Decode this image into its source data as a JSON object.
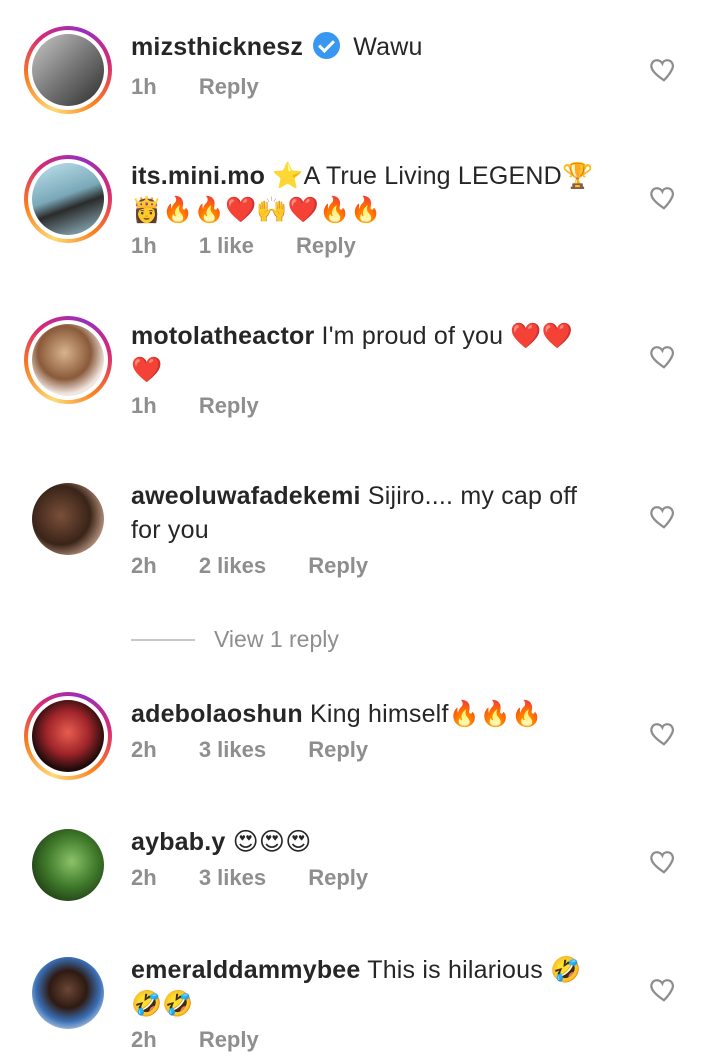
{
  "comments": [
    {
      "username": "mizsthicknesz",
      "verified": true,
      "text": "Wawu",
      "time": "1h",
      "likes": "",
      "reply": "Reply"
    },
    {
      "username": "its.mini.mo",
      "verified": false,
      "text": "⭐A True Living LEGEND🏆",
      "text2": "👸🔥🔥❤️🙌❤️🔥🔥",
      "time": "1h",
      "likes": "1 like",
      "reply": "Reply"
    },
    {
      "username": "motolatheactor",
      "verified": false,
      "text": "I'm proud of you ❤️❤️",
      "text2": "❤️",
      "time": "1h",
      "likes": "",
      "reply": "Reply"
    },
    {
      "username": "aweoluwafadekemi",
      "verified": false,
      "text": "Sijiro.... my cap off",
      "text2": "for you",
      "time": "2h",
      "likes": "2 likes",
      "reply": "Reply"
    },
    {
      "username": "adebolaoshun",
      "verified": false,
      "text": "King himself🔥🔥🔥",
      "time": "2h",
      "likes": "3 likes",
      "reply": "Reply"
    },
    {
      "username": "aybab.y",
      "verified": false,
      "text": "😍😍😍",
      "time": "2h",
      "likes": "3 likes",
      "reply": "Reply"
    },
    {
      "username": "emeralddammybee",
      "verified": false,
      "text": "This is hilarious 🤣",
      "text2": "🤣🤣",
      "time": "2h",
      "likes": "",
      "reply": "Reply"
    }
  ],
  "view_replies": "View 1 reply",
  "icons": {
    "like": "heart-outline-icon",
    "verified": "verified-badge-icon"
  },
  "colors": {
    "text": "#262626",
    "muted": "#8e8e8e",
    "verified": "#3897f0"
  }
}
